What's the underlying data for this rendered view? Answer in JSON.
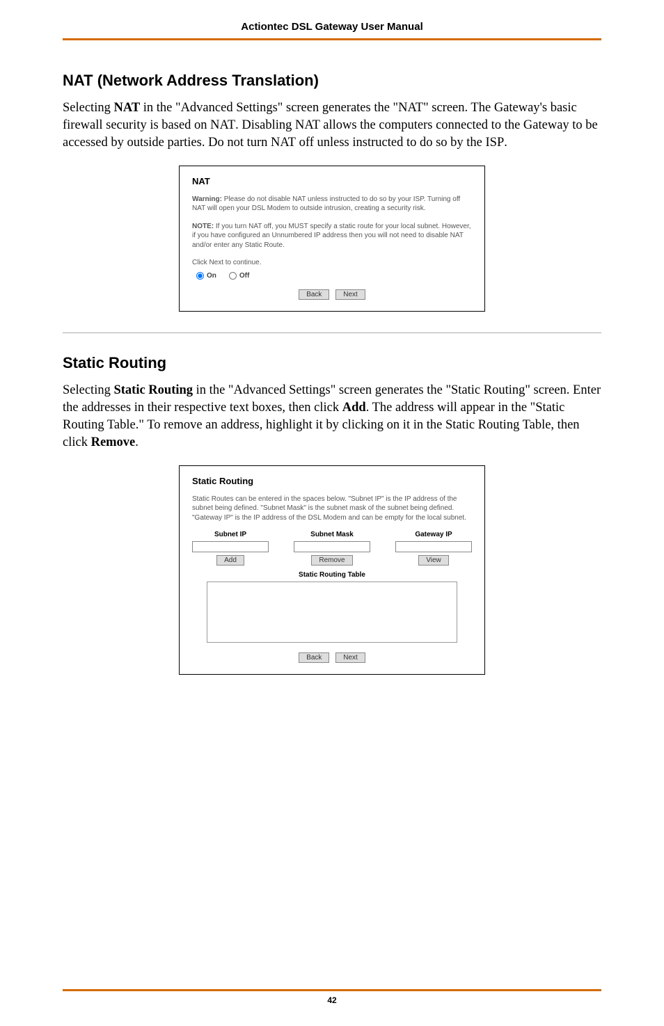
{
  "header": {
    "title": "Actiontec DSL Gateway User Manual"
  },
  "section1": {
    "heading": "NAT (Network Address Translation)",
    "para_pre": "Selecting ",
    "para_bold1": "NAT",
    "para_mid1": " in the \"Advanced Settings\" screen generates the \"",
    "para_sc1": "NAT",
    "para_mid2": "\" screen. The Gateway's basic firewall security is based on ",
    "para_sc2": "NAT",
    "para_mid3": ". Disabling NAT allows the computers connected to the Gateway to be accessed by outside parties. Do not turn ",
    "para_sc3": "NAT",
    "para_mid4": " off unless instructed to do so by the ",
    "para_sc4": "ISP",
    "para_end": "."
  },
  "nat_dialog": {
    "title": "NAT",
    "warning_label": "Warning:",
    "warning_text": " Please do not disable NAT unless instructed to do so by your ISP. Turning off NAT will open your DSL Modem to outside intrusion, creating a security risk.",
    "note_label": "NOTE:",
    "note_text": " If you turn NAT off, you MUST specify a static route for your local subnet. However, if you have configured an Unnumbered IP address then you will not need to disable NAT and/or enter any Static Route.",
    "continue_text": "Click Next to continue.",
    "on_label": "On",
    "off_label": "Off",
    "back_btn": "Back",
    "next_btn": "Next"
  },
  "section2": {
    "heading": "Static Routing",
    "para_pre": "Selecting ",
    "para_bold1": "Static Routing",
    "para_mid1": " in the \"Advanced Settings\" screen generates the \"Static Routing\" screen. Enter the addresses in their respective text boxes, then click ",
    "para_bold2": "Add",
    "para_mid2": ". The address will appear in the \"Static Routing Table.\" To remove an address, highlight it by clicking on it in the Static Routing Table, then click ",
    "para_bold3": "Remove",
    "para_end": "."
  },
  "sr_dialog": {
    "title": "Static Routing",
    "intro": "Static Routes can be entered in the spaces below. \"Subnet IP\" is the IP address of the subnet being defined. \"Subnet Mask\" is the subnet mask of the subnet being defined. \"Gateway IP\" is the IP address of the DSL Modem and can be empty for the local subnet.",
    "col1": "Subnet IP",
    "col2": "Subnet Mask",
    "col3": "Gateway IP",
    "add_btn": "Add",
    "remove_btn": "Remove",
    "view_btn": "View",
    "table_heading": "Static Routing Table",
    "back_btn": "Back",
    "next_btn": "Next"
  },
  "footer": {
    "page_number": "42"
  }
}
